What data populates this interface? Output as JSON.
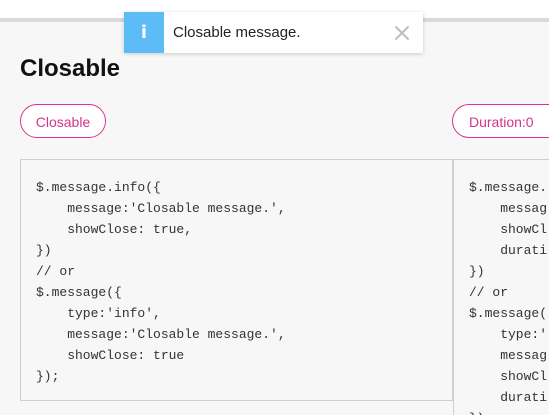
{
  "section": {
    "title": "Closable"
  },
  "buttons": {
    "closable": "Closable",
    "duration": "Duration:0"
  },
  "toast": {
    "icon_glyph": "i",
    "message": "Closable message.",
    "icon": "info-icon",
    "close_icon": "close-icon",
    "accent_color": "#5bbcf7"
  },
  "code": {
    "left": "$.message.info({\n    message:'Closable message.',\n    showClose: true,\n})\n// or\n$.message({\n    type:'info',\n    message:'Closable message.',\n    showClose: true\n});",
    "right": "$.message.\n    messag\n    showCl\n    durati\n})\n// or\n$.message(\n    type:'\n    messag\n    showCl\n    durati\n});"
  },
  "colors": {
    "button_accent": "#d6338a",
    "panel_background": "#f7f7f7"
  }
}
